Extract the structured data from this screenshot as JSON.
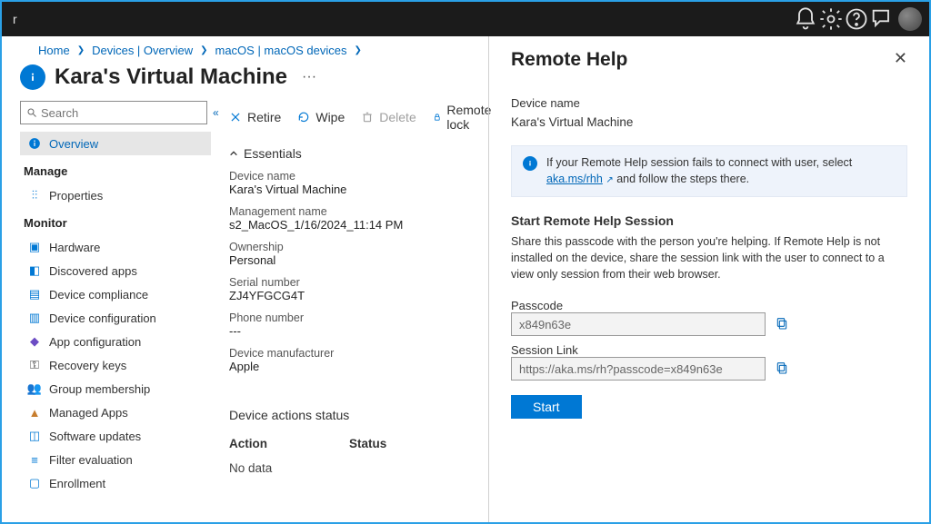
{
  "topbar": {
    "left_fragment": "r"
  },
  "breadcrumb": {
    "home": "Home",
    "devices": "Devices | Overview",
    "macos": "macOS | macOS devices"
  },
  "page": {
    "title": "Kara's Virtual Machine",
    "more": "···"
  },
  "search": {
    "placeholder": "Search",
    "collapse_glyph": "«"
  },
  "sidebar": {
    "overview": "Overview",
    "manage_header": "Manage",
    "properties": "Properties",
    "monitor_header": "Monitor",
    "items": [
      "Hardware",
      "Discovered apps",
      "Device compliance",
      "Device configuration",
      "App configuration",
      "Recovery keys",
      "Group membership",
      "Managed Apps",
      "Software updates",
      "Filter evaluation",
      "Enrollment"
    ]
  },
  "toolbar": {
    "retire": "Retire",
    "wipe": "Wipe",
    "delete": "Delete",
    "remote_lock": "Remote lock"
  },
  "essentials": {
    "header": "Essentials",
    "device_name_lbl": "Device name",
    "device_name": "Kara's Virtual Machine",
    "mgmt_name_lbl": "Management name",
    "mgmt_name": "s2_MacOS_1/16/2024_11:14 PM",
    "ownership_lbl": "Ownership",
    "ownership": "Personal",
    "serial_lbl": "Serial number",
    "serial": "ZJ4YFGCG4T",
    "phone_lbl": "Phone number",
    "phone": "---",
    "manufacturer_lbl": "Device manufacturer",
    "manufacturer": "Apple"
  },
  "actions": {
    "header": "Device actions status",
    "col_action": "Action",
    "col_status": "Status",
    "no_data": "No data"
  },
  "panel": {
    "title": "Remote Help",
    "device_name_lbl": "Device name",
    "device_name": "Kara's Virtual Machine",
    "alert_pre": "If your Remote Help session fails to connect with user, select ",
    "alert_link": "aka.ms/rhh",
    "alert_post": " and follow the steps there.",
    "section_header": "Start Remote Help Session",
    "section_desc": "Share this passcode with the person you're helping. If Remote Help is not installed on the device, share the session link with the user to connect to a view only session from their web browser.",
    "passcode_lbl": "Passcode",
    "passcode": "x849n63e",
    "sessionlink_lbl": "Session Link",
    "sessionlink": "https://aka.ms/rh?passcode=x849n63e",
    "start": "Start"
  },
  "icons": {
    "colors": {
      "primary": "#0078d4",
      "link": "#0067b8"
    }
  }
}
